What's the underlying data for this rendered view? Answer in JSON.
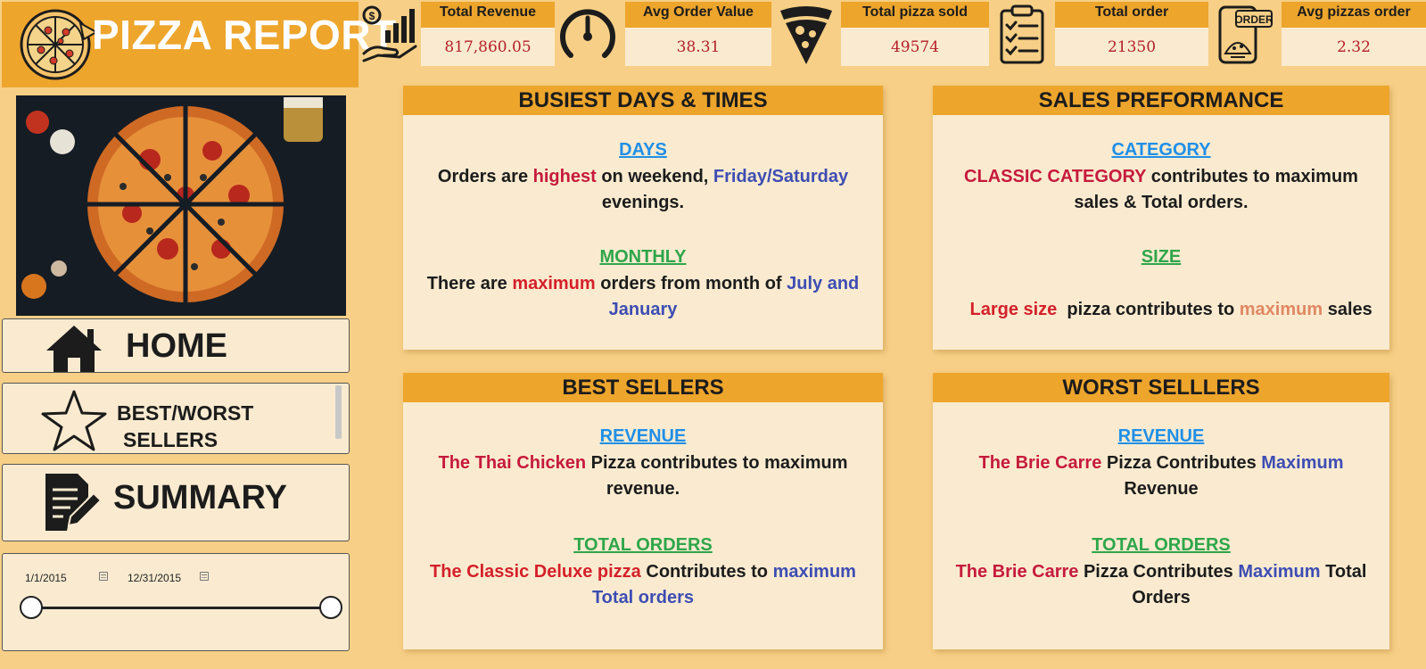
{
  "header": {
    "title": "PIZZA REPORT"
  },
  "kpis": [
    {
      "icon": "revenue-hand-icon",
      "label": "Total Revenue",
      "value": "817,860.05"
    },
    {
      "icon": "gauge-icon",
      "label": "Avg Order Value",
      "value": "38.31"
    },
    {
      "icon": "pizza-slice-icon",
      "label": "Total pizza sold",
      "value": "49574"
    },
    {
      "icon": "clipboard-checklist-icon",
      "label": "Total order",
      "value": "21350"
    },
    {
      "icon": "phone-order-icon",
      "label": "Avg pizzas order",
      "value": "2.32"
    }
  ],
  "nav": {
    "home": "HOME",
    "best_worst_1": "BEST/WORST",
    "best_worst_2": "SELLERS",
    "summary": "SUMMARY"
  },
  "date_filter": {
    "start": "1/1/2015",
    "end": "12/31/2015"
  },
  "panels": {
    "busiest": {
      "title": "BUSIEST DAYS & TIMES",
      "s1_title": "DAYS",
      "s1_a": "Orders are ",
      "s1_b": "highest",
      "s1_c": " on weekend, ",
      "s1_d": "Friday/Saturday",
      "s1_e": " evenings.",
      "s2_title": "MONTHLY",
      "s2_a": "There are ",
      "s2_b": "maximum",
      "s2_c": " orders from month of ",
      "s2_d": "July and January"
    },
    "sales": {
      "title": "SALES PREFORMANCE",
      "s1_title": "CATEGORY",
      "s1_a": "CLASSIC CATEGORY",
      "s1_b": " contributes to maximum sales & Total orders.",
      "s2_title": "SIZE",
      "s2_a": "Large size",
      "s2_b": "  pizza contributes to ",
      "s2_c": "maximum",
      "s2_d": " sales"
    },
    "best": {
      "title": "BEST SELLERS",
      "s1_title": "REVENUE",
      "s1_a": "The Thai Chicken",
      "s1_b": "  Pizza contributes to maximum revenue.",
      "s2_title": "TOTAL ORDERS",
      "s2_a": "The Classic Deluxe pizza",
      "s2_b": " Contributes to ",
      "s2_c": "maximum Total orders"
    },
    "worst": {
      "title": "WORST SELLLERS",
      "s1_title": "REVENUE",
      "s1_a": "The Brie Carre",
      "s1_b": " Pizza Contributes ",
      "s1_c": "Maximum",
      "s1_d": " Revenue",
      "s2_title": "TOTAL ORDERS",
      "s2_a": "The Brie Carre",
      "s2_b": " Pizza Contributes ",
      "s2_c": "Maximum",
      "s2_d": " Total Orders"
    }
  },
  "colors": {
    "background": "#f7cf86",
    "accent": "#eda52c",
    "card": "#faebd0",
    "highlight_red": "#c61a3c",
    "highlight_blue": "#3d4db3",
    "link_blue": "#1f8fe8",
    "green": "#2ea64b"
  }
}
